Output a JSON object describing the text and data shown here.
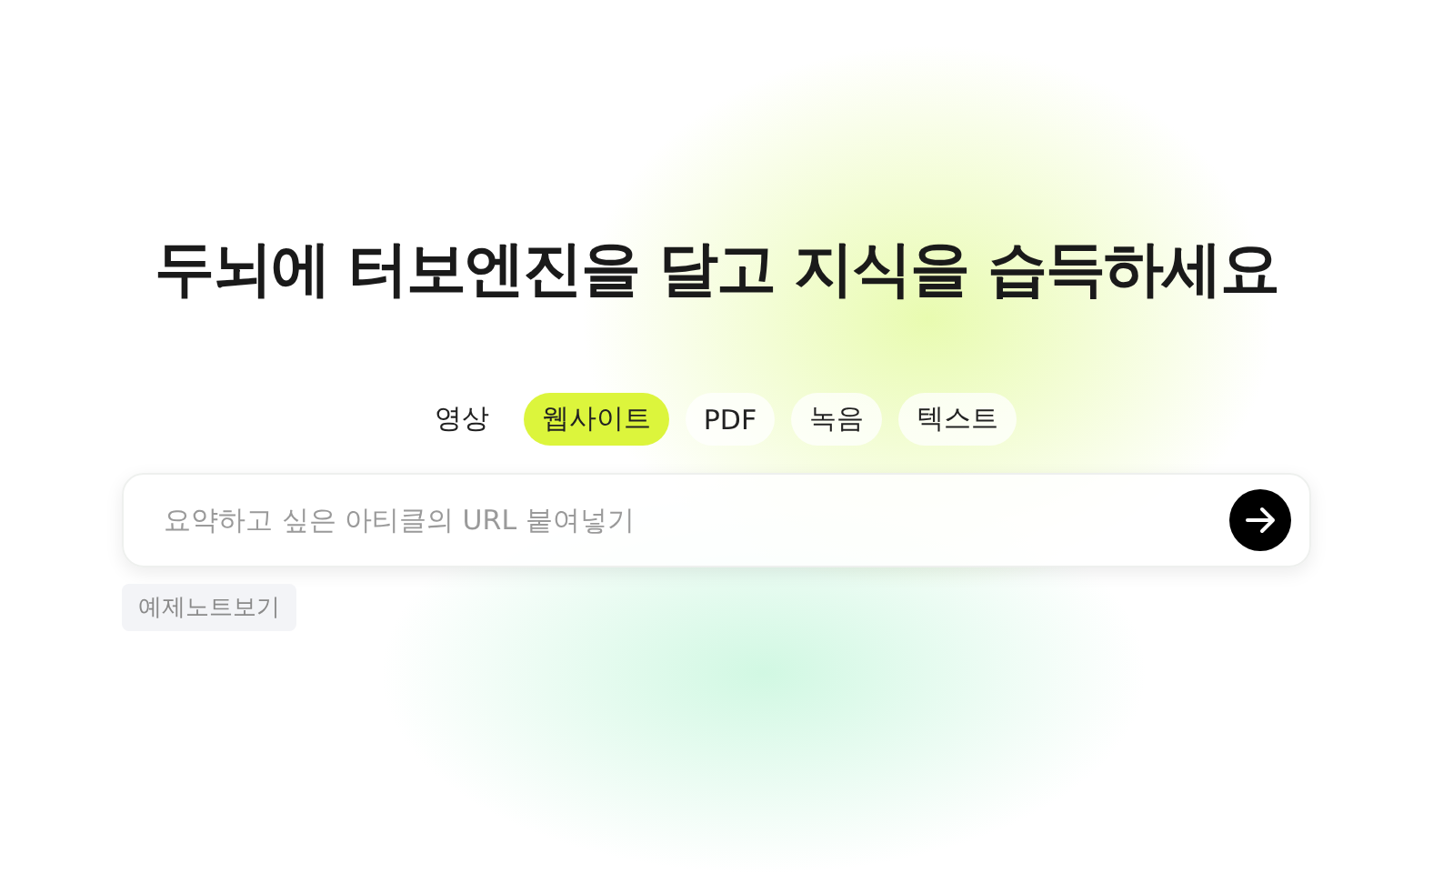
{
  "headline": "두뇌에 터보엔진을 달고 지식을 습득하세요",
  "tabs": [
    {
      "label": "영상",
      "selected": false
    },
    {
      "label": "웹사이트",
      "selected": true
    },
    {
      "label": "PDF",
      "selected": false
    },
    {
      "label": "녹음",
      "selected": false
    },
    {
      "label": "텍스트",
      "selected": false
    }
  ],
  "search": {
    "placeholder": "요약하고 싶은 아티클의 URL 붙여넣기"
  },
  "example_button": "예제노트보기"
}
